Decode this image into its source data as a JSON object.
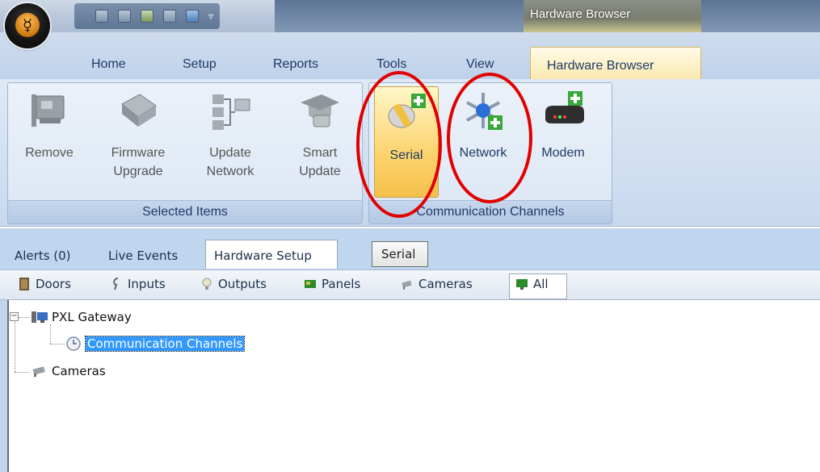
{
  "window": {
    "title": "Hardware Browser"
  },
  "quick_access": {
    "icons": [
      "save-icon",
      "save-all-icon",
      "users-icon",
      "print-icon",
      "monitor-icon"
    ],
    "more_label": "▿"
  },
  "ribbon_tabs": [
    "Home",
    "Setup",
    "Reports",
    "Tools",
    "View",
    "Hardware Browser"
  ],
  "ribbon": {
    "selected_items": {
      "label": "Selected Items",
      "buttons": [
        {
          "label1": "Remove",
          "label2": "",
          "icon": "card-icon"
        },
        {
          "label1": "Firmware",
          "label2": "Upgrade",
          "icon": "chip-icon"
        },
        {
          "label1": "Update",
          "label2": "Network",
          "icon": "network-tree-icon"
        },
        {
          "label1": "Smart",
          "label2": "Update",
          "icon": "graduation-cap-icon"
        }
      ]
    },
    "communication_channels": {
      "label": "Communication Channels",
      "buttons": [
        {
          "label": "Serial",
          "icon": "serial-plug-add-icon"
        },
        {
          "label": "Network",
          "icon": "network-add-icon"
        },
        {
          "label": "Modem",
          "icon": "modem-add-icon"
        }
      ]
    }
  },
  "view_tabs": [
    "Alerts (0)",
    "Live Events",
    "Hardware Setup"
  ],
  "serial_tab": "Serial",
  "filters": [
    {
      "label": "Doors",
      "icon": "door-icon"
    },
    {
      "label": "Inputs",
      "icon": "input-icon"
    },
    {
      "label": "Outputs",
      "icon": "bulb-icon"
    },
    {
      "label": "Panels",
      "icon": "panel-icon"
    },
    {
      "label": "Cameras",
      "icon": "camera-icon"
    },
    {
      "label": "All",
      "icon": "all-icon"
    }
  ],
  "tree": {
    "root": "PXL Gateway",
    "child": "Communication Channels",
    "sibling": "Cameras",
    "expander": "−"
  }
}
